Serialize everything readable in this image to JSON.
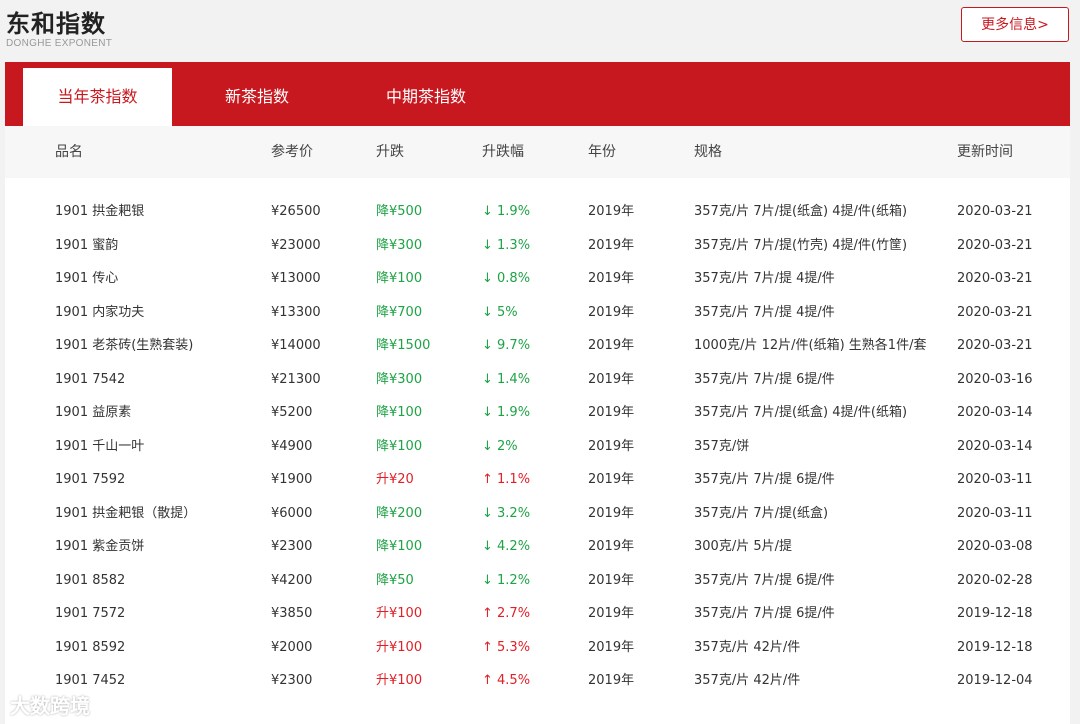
{
  "header": {
    "title": "东和指数",
    "subtitle": "DONGHE EXPONENT",
    "more_label": "更多信息>"
  },
  "tabs": [
    {
      "label": "当年茶指数",
      "active": true
    },
    {
      "label": "新茶指数",
      "active": false
    },
    {
      "label": "中期茶指数",
      "active": false
    }
  ],
  "columns": [
    "品名",
    "参考价",
    "升跌",
    "升跌幅",
    "年份",
    "规格",
    "更新时间"
  ],
  "colors": {
    "accent": "#c8181f",
    "down": "#1ea346",
    "up": "#e01f26"
  },
  "rows": [
    {
      "name": "1901 拱金耙银",
      "price": "¥26500",
      "change": "降¥500",
      "pct": "↓ 1.9%",
      "dir": "down",
      "year": "2019年",
      "spec": "357克/片 7片/提(纸盒) 4提/件(纸箱)",
      "date": "2020-03-21"
    },
    {
      "name": "1901 蜜韵",
      "price": "¥23000",
      "change": "降¥300",
      "pct": "↓ 1.3%",
      "dir": "down",
      "year": "2019年",
      "spec": "357克/片 7片/提(竹壳) 4提/件(竹筐)",
      "date": "2020-03-21"
    },
    {
      "name": "1901 传心",
      "price": "¥13000",
      "change": "降¥100",
      "pct": "↓ 0.8%",
      "dir": "down",
      "year": "2019年",
      "spec": "357克/片 7片/提 4提/件",
      "date": "2020-03-21"
    },
    {
      "name": "1901 内家功夫",
      "price": "¥13300",
      "change": "降¥700",
      "pct": "↓ 5%",
      "dir": "down",
      "year": "2019年",
      "spec": "357克/片 7片/提 4提/件",
      "date": "2020-03-21"
    },
    {
      "name": "1901 老茶砖(生熟套装)",
      "price": "¥14000",
      "change": "降¥1500",
      "pct": "↓ 9.7%",
      "dir": "down",
      "year": "2019年",
      "spec": "1000克/片 12片/件(纸箱) 生熟各1件/套",
      "date": "2020-03-21"
    },
    {
      "name": "1901 7542",
      "price": "¥21300",
      "change": "降¥300",
      "pct": "↓ 1.4%",
      "dir": "down",
      "year": "2019年",
      "spec": "357克/片 7片/提 6提/件",
      "date": "2020-03-16"
    },
    {
      "name": "1901 益原素",
      "price": "¥5200",
      "change": "降¥100",
      "pct": "↓ 1.9%",
      "dir": "down",
      "year": "2019年",
      "spec": "357克/片 7片/提(纸盒) 4提/件(纸箱)",
      "date": "2020-03-14"
    },
    {
      "name": "1901 千山一叶",
      "price": "¥4900",
      "change": "降¥100",
      "pct": "↓ 2%",
      "dir": "down",
      "year": "2019年",
      "spec": "357克/饼",
      "date": "2020-03-14"
    },
    {
      "name": "1901 7592",
      "price": "¥1900",
      "change": "升¥20",
      "pct": "↑ 1.1%",
      "dir": "up",
      "year": "2019年",
      "spec": "357克/片 7片/提 6提/件",
      "date": "2020-03-11"
    },
    {
      "name": "1901 拱金耙银（散提）",
      "price": "¥6000",
      "change": "降¥200",
      "pct": "↓ 3.2%",
      "dir": "down",
      "year": "2019年",
      "spec": "357克/片 7片/提(纸盒)",
      "date": "2020-03-11"
    },
    {
      "name": "1901 紫金贡饼",
      "price": "¥2300",
      "change": "降¥100",
      "pct": "↓ 4.2%",
      "dir": "down",
      "year": "2019年",
      "spec": "300克/片 5片/提",
      "date": "2020-03-08"
    },
    {
      "name": "1901 8582",
      "price": "¥4200",
      "change": "降¥50",
      "pct": "↓ 1.2%",
      "dir": "down",
      "year": "2019年",
      "spec": "357克/片 7片/提 6提/件",
      "date": "2020-02-28"
    },
    {
      "name": "1901 7572",
      "price": "¥3850",
      "change": "升¥100",
      "pct": "↑ 2.7%",
      "dir": "up",
      "year": "2019年",
      "spec": "357克/片 7片/提 6提/件",
      "date": "2019-12-18"
    },
    {
      "name": "1901 8592",
      "price": "¥2000",
      "change": "升¥100",
      "pct": "↑ 5.3%",
      "dir": "up",
      "year": "2019年",
      "spec": "357克/片 42片/件",
      "date": "2019-12-18"
    },
    {
      "name": "1901 7452",
      "price": "¥2300",
      "change": "升¥100",
      "pct": "↑ 4.5%",
      "dir": "up",
      "year": "2019年",
      "spec": "357克/片 42片/件",
      "date": "2019-12-04"
    }
  ],
  "watermark": "大数跨境"
}
